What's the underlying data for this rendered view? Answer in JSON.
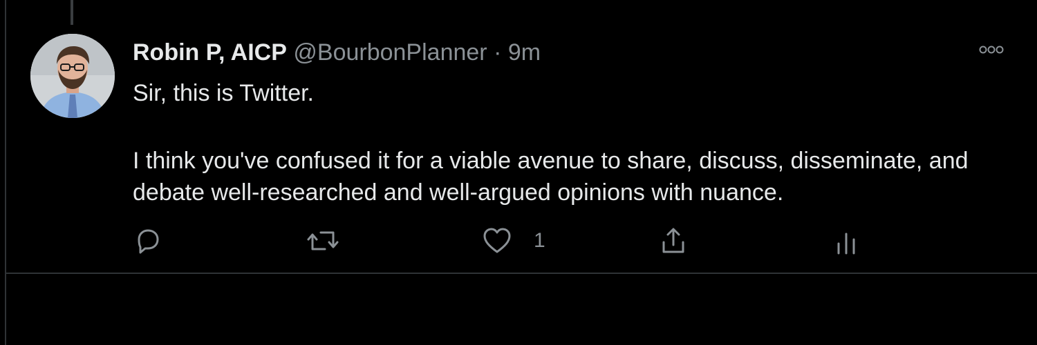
{
  "tweet": {
    "author_name": "Robin P, AICP",
    "handle": "@BourbonPlanner",
    "separator": "·",
    "time": "9m",
    "text_line1": "Sir, this is Twitter.",
    "text_line2": "I think you've confused it for a viable avenue to share, discuss, disseminate, and debate well-researched and well-argued opinions with nuance."
  },
  "actions": {
    "reply_icon": "reply-icon",
    "retweet_icon": "retweet-icon",
    "like_icon": "heart-icon",
    "like_count": "1",
    "share_icon": "share-icon",
    "analytics_icon": "analytics-icon"
  },
  "colors": {
    "background": "#000000",
    "text": "#e7e9ea",
    "muted": "#8b9196",
    "divider": "#2f3336"
  }
}
